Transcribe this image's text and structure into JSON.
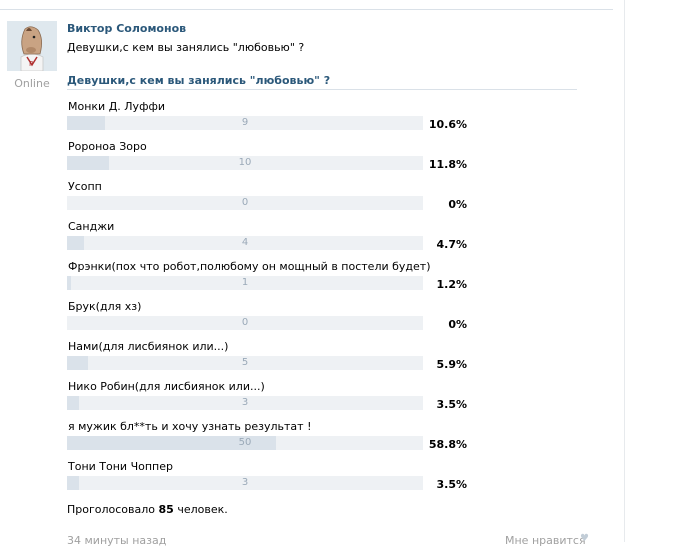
{
  "post": {
    "author": "Виктор Соломонов",
    "text": "Девушки,с кем вы занялись \"любовью\" ?",
    "status": "Online",
    "time": "34 минуты назад",
    "like_label": "Мне нравится",
    "avatar_icon": "horse-mask-avatar-icon"
  },
  "poll": {
    "title": "Девушки,с кем вы занялись \"любовью\" ?",
    "options": [
      {
        "label": "Монки Д. Луффи",
        "count": "9",
        "percent": "10.6%",
        "fraction": 0.106
      },
      {
        "label": "Ророноа Зоро",
        "count": "10",
        "percent": "11.8%",
        "fraction": 0.118
      },
      {
        "label": "Усопп",
        "count": "0",
        "percent": "0%",
        "fraction": 0
      },
      {
        "label": "Санджи",
        "count": "4",
        "percent": "4.7%",
        "fraction": 0.047
      },
      {
        "label": "Фрэнки(пох что робот,полюбому он мощный в постели будет)",
        "count": "1",
        "percent": "1.2%",
        "fraction": 0.012
      },
      {
        "label": "Брук(для хз)",
        "count": "0",
        "percent": "0%",
        "fraction": 0
      },
      {
        "label": "Нами(для лисбиянок или...)",
        "count": "5",
        "percent": "5.9%",
        "fraction": 0.059
      },
      {
        "label": "Нико Робин(для лисбиянок или...)",
        "count": "3",
        "percent": "3.5%",
        "fraction": 0.035
      },
      {
        "label": "я мужик бл**ть и хочу узнать результат !",
        "count": "50",
        "percent": "58.8%",
        "fraction": 0.588
      },
      {
        "label": "Тони Тони Чоппер",
        "count": "3",
        "percent": "3.5%",
        "fraction": 0.035
      }
    ],
    "voted_prefix": "Проголосовало",
    "voted_count": "85",
    "voted_suffix": "человек."
  },
  "colors": {
    "link": "#2b587a",
    "bar_fill": "#dae2ea",
    "bar_track": "#eef1f4",
    "muted": "#a0a0a0"
  }
}
